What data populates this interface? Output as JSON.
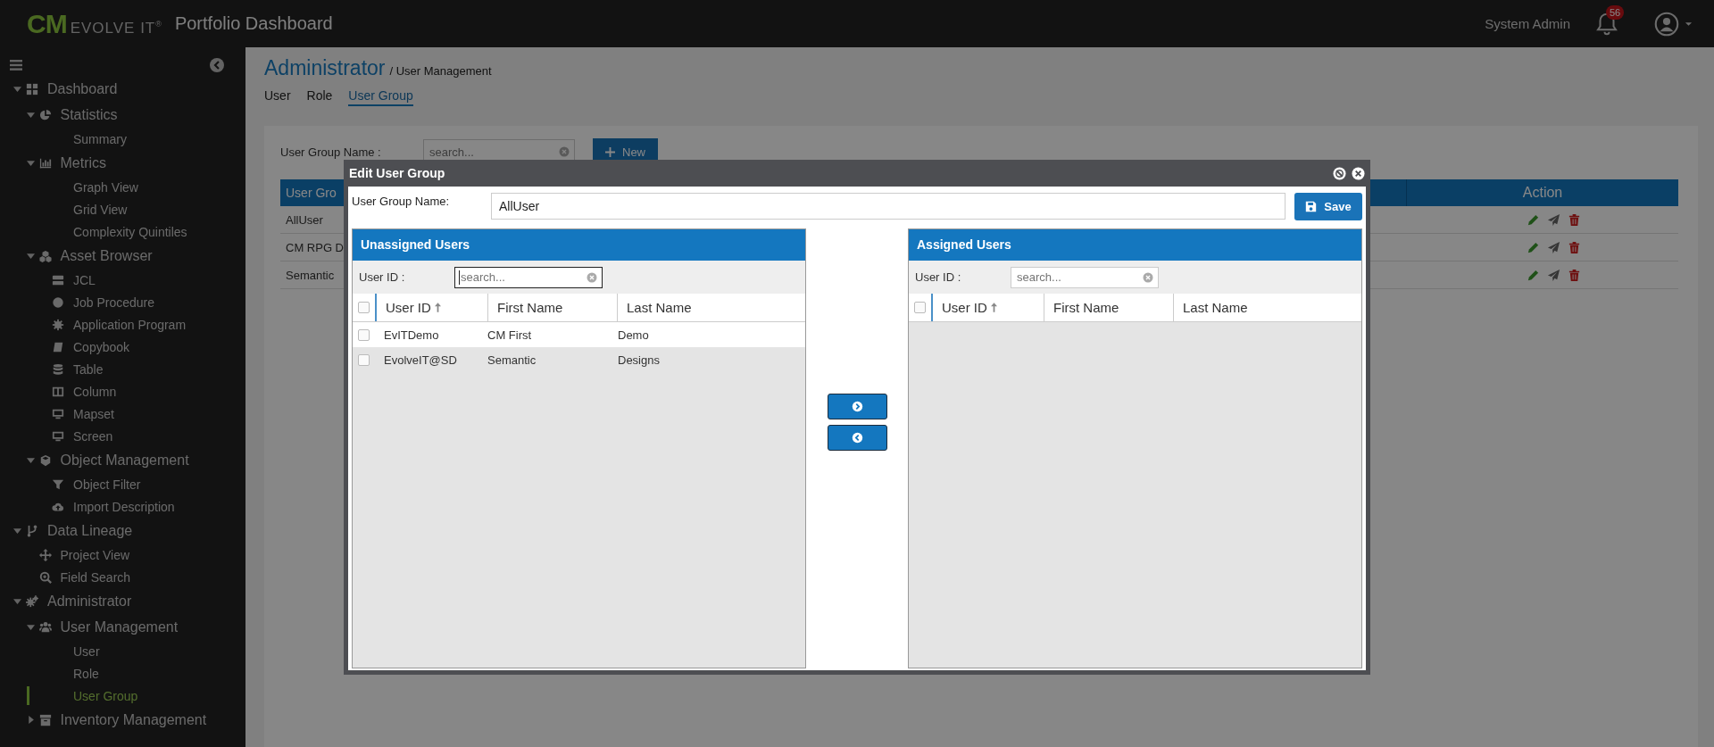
{
  "header": {
    "logo_mark": "CM",
    "logo_text": "EVOLVE IT",
    "logo_reg": "®",
    "title": "Portfolio Dashboard",
    "user": "System Admin",
    "notifications": "56"
  },
  "sidebar": {
    "items": [
      {
        "label": "Dashboard",
        "expanded": true,
        "selected": false,
        "children": [
          {
            "label": "Statistics",
            "expanded": true,
            "selected": false,
            "children": [
              {
                "label": "Summary",
                "selected": false
              }
            ]
          },
          {
            "label": "Metrics",
            "expanded": true,
            "selected": false,
            "children": [
              {
                "label": "Graph View",
                "selected": false
              },
              {
                "label": "Grid View",
                "selected": false
              },
              {
                "label": "Complexity Quintiles",
                "selected": false
              }
            ]
          },
          {
            "label": "Asset Browser",
            "expanded": true,
            "selected": false,
            "children": [
              {
                "label": "JCL",
                "selected": false
              },
              {
                "label": "Job Procedure",
                "selected": false
              },
              {
                "label": "Application Program",
                "selected": false
              },
              {
                "label": "Copybook",
                "selected": false
              },
              {
                "label": "Table",
                "selected": false
              },
              {
                "label": "Column",
                "selected": false
              },
              {
                "label": "Mapset",
                "selected": false
              },
              {
                "label": "Screen",
                "selected": false
              }
            ]
          },
          {
            "label": "Object Management",
            "expanded": true,
            "selected": false,
            "children": [
              {
                "label": "Object Filter",
                "selected": false
              },
              {
                "label": "Import Description",
                "selected": false
              }
            ]
          }
        ]
      },
      {
        "label": "Data Lineage",
        "expanded": true,
        "selected": false,
        "children": [
          {
            "label": "Project View",
            "selected": false
          },
          {
            "label": "Field Search",
            "selected": false
          }
        ]
      },
      {
        "label": "Administrator",
        "expanded": true,
        "selected": false,
        "children": [
          {
            "label": "User Management",
            "expanded": true,
            "selected": false,
            "children": [
              {
                "label": "User",
                "selected": false
              },
              {
                "label": "Role",
                "selected": false
              },
              {
                "label": "User Group",
                "selected": true
              }
            ]
          },
          {
            "label": "Inventory Management",
            "expanded": false,
            "selected": false
          }
        ]
      }
    ]
  },
  "page": {
    "title": "Administrator",
    "breadcrumb": "/ User Management",
    "tabs": [
      {
        "label": "User",
        "selected": false
      },
      {
        "label": "Role",
        "selected": false
      },
      {
        "label": "User Group",
        "selected": true
      }
    ],
    "filter": {
      "label": "User Group Name :",
      "placeholder": "search...",
      "new_button": "New"
    },
    "table": {
      "columns": [
        "User Gro",
        "Action"
      ],
      "rows": [
        {
          "name": "AllUser"
        },
        {
          "name": "CM RPG D"
        },
        {
          "name": "Semantic"
        }
      ]
    }
  },
  "dialog": {
    "title": "Edit User Group",
    "name_label": "User Group Name:",
    "name_value": "AllUser",
    "save": "Save",
    "panels": [
      {
        "title": "Unassigned Users",
        "filter_label": "User ID :",
        "placeholder": "search...",
        "focused": true,
        "all_checked": false,
        "columns": [
          {
            "label": "User ID",
            "sorted": true
          },
          {
            "label": "First Name",
            "sorted": false
          },
          {
            "label": "Last Name",
            "sorted": false
          }
        ],
        "rows": [
          {
            "checked": false,
            "cells": [
              "EvITDemo",
              "CM First",
              "Demo"
            ]
          },
          {
            "checked": false,
            "cells": [
              "EvolveIT@SD",
              "Semantic",
              "Designs"
            ]
          }
        ]
      },
      {
        "title": "Assigned Users",
        "filter_label": "User ID :",
        "placeholder": "search...",
        "focused": false,
        "all_checked": false,
        "columns": [
          {
            "label": "User ID",
            "sorted": true
          },
          {
            "label": "First Name",
            "sorted": false
          },
          {
            "label": "Last Name",
            "sorted": false
          }
        ]
      }
    ]
  }
}
